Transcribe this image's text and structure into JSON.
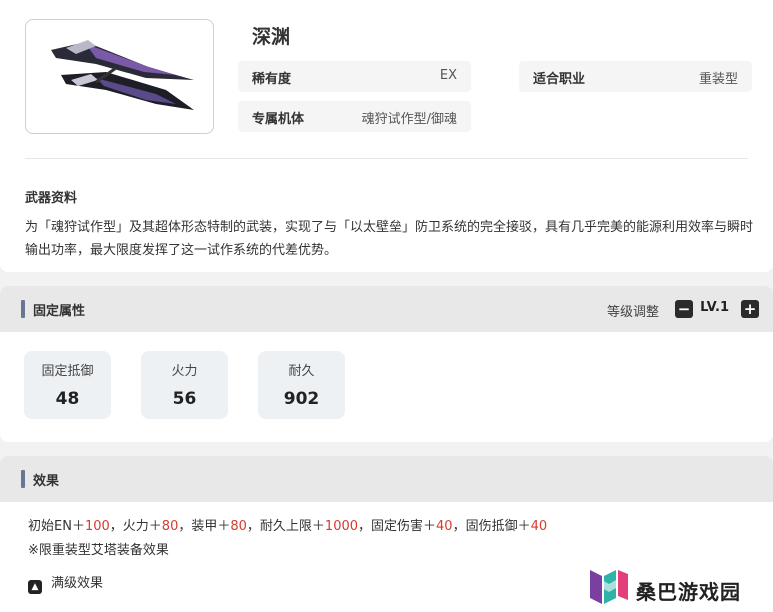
{
  "weapon": {
    "name": "深渊",
    "image_icon": "weapon-illustration",
    "fields": {
      "rarity": {
        "label": "稀有度",
        "value": "EX"
      },
      "class": {
        "label": "适合职业",
        "value": "重装型"
      },
      "exclusive": {
        "label": "专属机体",
        "value": "魂狩试作型/御魂"
      }
    }
  },
  "info": {
    "section_label": "武器资料",
    "description": "为「魂狩试作型」及其超体形态特制的武装，实现了与「以太壁垒」防卫系统的完全接驳，具有几乎完美的能源利用效率与瞬时输出功率，最大限度发挥了这一试作系统的代差优势。"
  },
  "attributes": {
    "title": "固定属性",
    "level_label": "等级调整",
    "level_value": "LV.1",
    "minus": "−",
    "plus": "+",
    "stats": [
      {
        "label": "固定抵御",
        "value": "48"
      },
      {
        "label": "火力",
        "value": "56"
      },
      {
        "label": "耐久",
        "value": "902"
      }
    ]
  },
  "effect": {
    "title": "效果",
    "parts": [
      {
        "t": "初始EN＋",
        "v": "100"
      },
      {
        "t": "，火力＋",
        "v": "80"
      },
      {
        "t": "，装甲＋",
        "v": "80"
      },
      {
        "t": "，耐久上限＋",
        "v": "1000"
      },
      {
        "t": "，固定伤害＋",
        "v": "40"
      },
      {
        "t": "，固伤抵御＋",
        "v": "40"
      }
    ],
    "note": "※限重装型艾塔装备效果",
    "max_label": "满级效果",
    "max_icon": "up-arrow-icon"
  },
  "watermark": {
    "text": "桑巴游戏园",
    "icon": "sangba-logo-icon"
  },
  "colors": {
    "accent_bar": "#6b7594",
    "value_red": "#d83a2e",
    "panel_bg": "#f2f2f2"
  }
}
